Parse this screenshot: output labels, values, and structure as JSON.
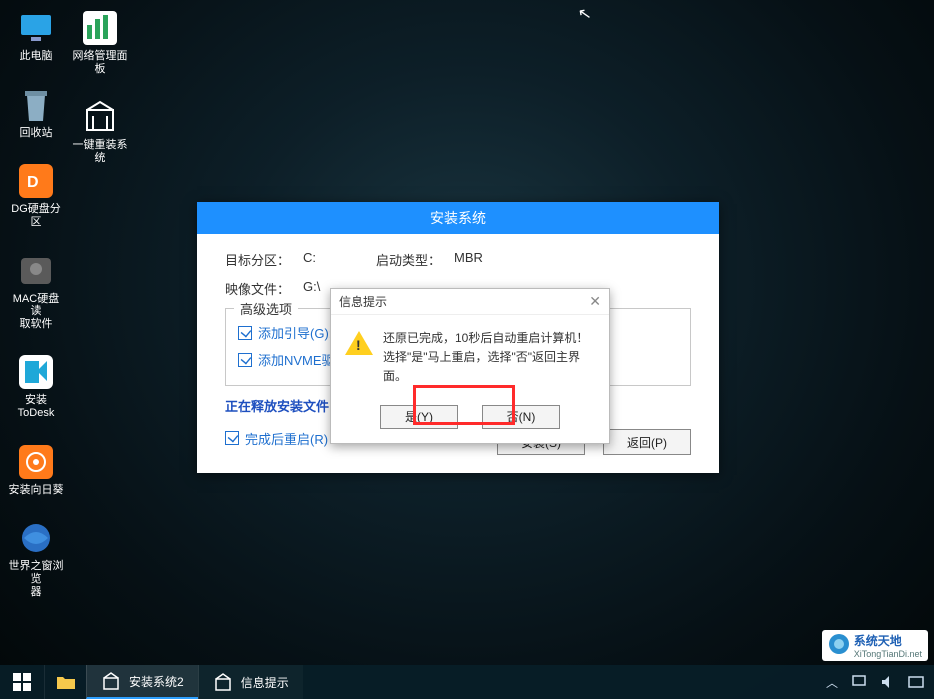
{
  "desktop": {
    "col1": [
      {
        "label": "此电脑",
        "name": "this-pc"
      },
      {
        "label": "回收站",
        "name": "recycle-bin"
      },
      {
        "label": "DG硬盘分区",
        "name": "dg-partition"
      },
      {
        "label": "MAC硬盘读\n取软件",
        "name": "mac-disk-reader"
      },
      {
        "label": "安装ToDesk",
        "name": "install-todesk"
      },
      {
        "label": "安装向日葵",
        "name": "install-sunlogin"
      },
      {
        "label": "世界之窗浏览\n器",
        "name": "theworld-browser"
      }
    ],
    "col2": [
      {
        "label": "网络管理面板",
        "name": "network-panel"
      },
      {
        "label": "一键重装系统",
        "name": "reinstall-system"
      }
    ]
  },
  "install_window": {
    "title": "安装系统",
    "target_label": "目标分区：",
    "target_value": "C:",
    "boot_label": "启动类型：",
    "boot_value": "MBR",
    "image_label": "映像文件：",
    "image_value": "G:\\",
    "advanced_label": "高级选项",
    "chk_boot": "添加引导(G):",
    "chk_nvme": "添加NVME驱",
    "releasing": "正在释放安装文件",
    "chk_restart": "完成后重启(R)",
    "btn_install": "安装(S)",
    "btn_return": "返回(P)"
  },
  "modal": {
    "title": "信息提示",
    "line1": "还原已完成，10秒后自动重启计算机！",
    "line2": "选择\"是\"马上重启，选择\"否\"返回主界面。",
    "btn_yes": "是(Y)",
    "btn_no": "否(N)"
  },
  "taskbar": {
    "task1": "安装系统2",
    "task2": "信息提示"
  },
  "watermark": {
    "text": "系统天地",
    "sub": "XiTongTianDi.net"
  }
}
